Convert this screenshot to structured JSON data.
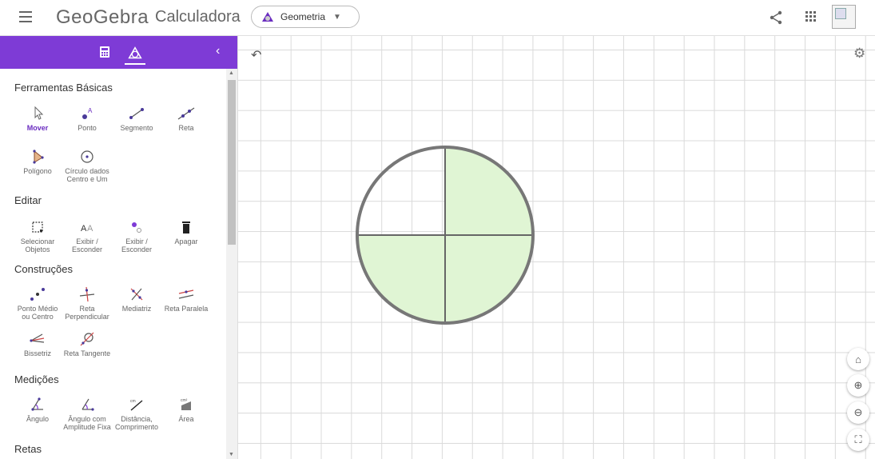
{
  "header": {
    "brand": "GeoGebra",
    "app_name": "Calculadora",
    "app_switch_label": "Geometria",
    "menu_icon": "hamburger-menu-icon",
    "share_icon": "share-icon",
    "apps_icon": "apps-grid-icon"
  },
  "sidebar": {
    "accent_color": "#7e3bd6",
    "tabs": [
      "calculator-icon",
      "tools-icon"
    ],
    "sections": [
      {
        "title": "Ferramentas Básicas",
        "tools": [
          {
            "label": "Mover",
            "icon": "cursor-arrow-icon",
            "active": true
          },
          {
            "label": "Ponto",
            "icon": "point-icon"
          },
          {
            "label": "Segmento",
            "icon": "segment-icon"
          },
          {
            "label": "Reta",
            "icon": "line-icon"
          },
          {
            "label": "Polígono",
            "icon": "polygon-icon"
          },
          {
            "label": "Círculo dados Centro e Um",
            "icon": "circle-center-point-icon"
          }
        ]
      },
      {
        "title": "Editar",
        "tools": [
          {
            "label": "Selecionar Objetos",
            "icon": "select-objects-icon"
          },
          {
            "label": "Exibir / Esconder",
            "icon": "show-hide-label-icon"
          },
          {
            "label": "Exibir / Esconder",
            "icon": "show-hide-object-icon"
          },
          {
            "label": "Apagar",
            "icon": "delete-icon"
          }
        ]
      },
      {
        "title": "Construções",
        "tools": [
          {
            "label": "Ponto Médio ou Centro",
            "icon": "midpoint-icon"
          },
          {
            "label": "Reta Perpendicular",
            "icon": "perpendicular-line-icon"
          },
          {
            "label": "Mediatriz",
            "icon": "perpendicular-bisector-icon"
          },
          {
            "label": "Reta Paralela",
            "icon": "parallel-line-icon"
          },
          {
            "label": "Bissetriz",
            "icon": "angle-bisector-icon"
          },
          {
            "label": "Reta Tangente",
            "icon": "tangent-line-icon"
          }
        ]
      },
      {
        "title": "Medições",
        "tools": [
          {
            "label": "Ângulo",
            "icon": "angle-icon"
          },
          {
            "label": "Ângulo com Amplitude Fixa",
            "icon": "angle-fixed-size-icon"
          },
          {
            "label": "Distância, Comprimento",
            "icon": "distance-icon"
          },
          {
            "label": "Área",
            "icon": "area-icon"
          }
        ]
      },
      {
        "title": "Retas",
        "tools": []
      }
    ]
  },
  "graphics": {
    "fill_color": "#e0f5d4",
    "circle_color": "#777777",
    "shaded_quarters": [
      "top-right",
      "bottom-left",
      "bottom-right"
    ],
    "buttons": [
      "undo-icon",
      "settings-gear-icon",
      "home-icon",
      "zoom-in-icon",
      "zoom-out-icon",
      "fullscreen-icon"
    ]
  }
}
